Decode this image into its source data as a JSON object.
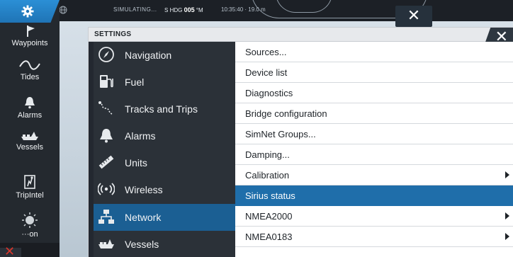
{
  "statusbar": {
    "mode": "SIMULATING...",
    "heading_prefix": "S",
    "heading_label": "HDG",
    "heading_value": "005",
    "heading_unit": "°M",
    "time_depth": "10:35:40 · 19.0 m"
  },
  "sidebar": {
    "items": [
      {
        "label": "Waypoints",
        "icon": "flag-icon"
      },
      {
        "label": "Tides",
        "icon": "wave-icon"
      },
      {
        "label": "Alarms",
        "icon": "bell-icon"
      },
      {
        "label": "Vessels",
        "icon": "ship-icon"
      },
      {
        "label": "TripIntel",
        "icon": "trip-icon"
      },
      {
        "label": "···on",
        "icon": "sun-icon"
      }
    ]
  },
  "dialog": {
    "title": "SETTINGS",
    "close_glyph": "✕",
    "categories": [
      {
        "label": "Navigation",
        "icon": "compass-icon"
      },
      {
        "label": "Fuel",
        "icon": "fuel-pump-icon"
      },
      {
        "label": "Tracks and Trips",
        "icon": "tracks-icon"
      },
      {
        "label": "Alarms",
        "icon": "bell-icon"
      },
      {
        "label": "Units",
        "icon": "ruler-icon"
      },
      {
        "label": "Wireless",
        "icon": "wireless-icon"
      },
      {
        "label": "Network",
        "icon": "network-icon",
        "active": true
      },
      {
        "label": "Vessels",
        "icon": "ship-icon"
      }
    ],
    "options": [
      {
        "label": "Sources...",
        "submenu": false
      },
      {
        "label": "Device list",
        "submenu": false
      },
      {
        "label": "Diagnostics",
        "submenu": false
      },
      {
        "label": "Bridge configuration",
        "submenu": false
      },
      {
        "label": "SimNet Groups...",
        "submenu": false
      },
      {
        "label": "Damping...",
        "submenu": false
      },
      {
        "label": "Calibration",
        "submenu": true
      },
      {
        "label": "Sirius status",
        "submenu": false,
        "selected": true
      },
      {
        "label": "NMEA2000",
        "submenu": true
      },
      {
        "label": "NMEA0183",
        "submenu": true
      }
    ]
  },
  "top_close_glyph": "✕",
  "colors": {
    "accent": "#1f6eaa",
    "active_category": "#1b5f93",
    "sidebar_bg": "#24292f",
    "category_bg": "#2b3138"
  }
}
